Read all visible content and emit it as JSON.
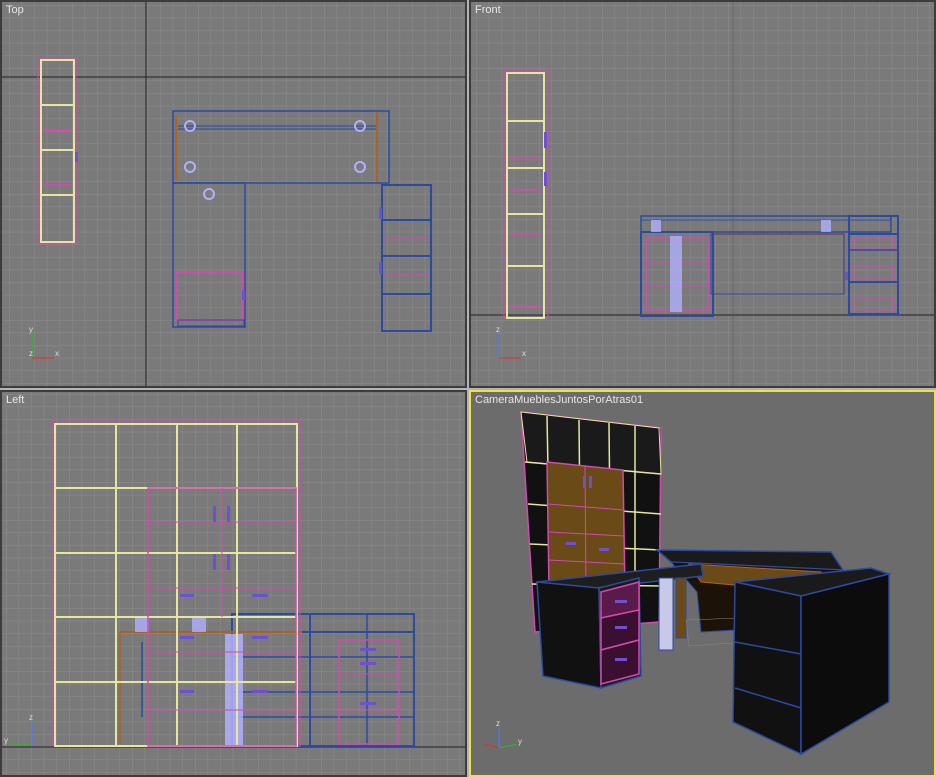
{
  "viewports": {
    "top": {
      "label": "Top"
    },
    "front": {
      "label": "Front"
    },
    "left": {
      "label": "Left"
    },
    "camera": {
      "label": "CameraMueblesJuntosPorAtras01"
    }
  },
  "axes": {
    "y": "y",
    "x": "x",
    "z": "z"
  },
  "colors": {
    "viewport_bg": "#7a7a7a",
    "grid": "#8a8a8a",
    "active_border": "#f0e040",
    "wire_yellow": "#e6e6a0",
    "wire_pink": "#d04ab0",
    "wire_blue": "#2c4aa0",
    "wire_orange": "#b06020",
    "wire_violet": "#7050d0",
    "camera_bg": "#6c6c6c"
  }
}
